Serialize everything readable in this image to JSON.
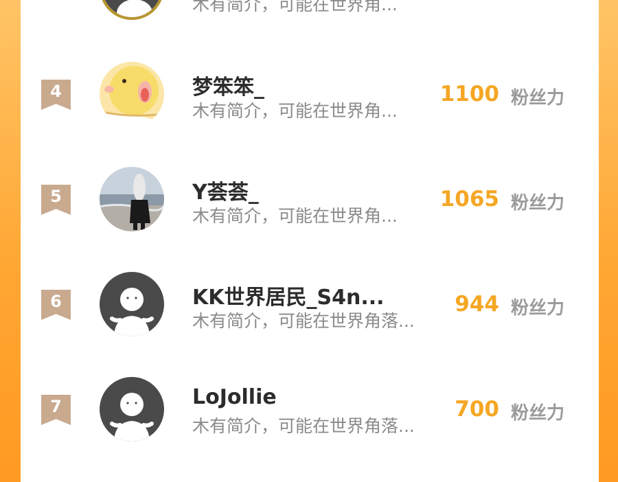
{
  "top_partial": {
    "bio": "木有简介，可能在世界角..."
  },
  "rows": [
    {
      "rank": "4",
      "name": "梦笨笨_",
      "bio": "木有简介，可能在世界角...",
      "score": "1100",
      "unit": "粉丝力",
      "avatar": "cartoon-chick-avatar"
    },
    {
      "rank": "5",
      "name": "Y荟荟_",
      "bio": "木有简介，可能在世界角...",
      "score": "1065",
      "unit": "粉丝力",
      "avatar": "beach-photo-avatar"
    },
    {
      "rank": "6",
      "name": "KK世界居民_S4n...",
      "bio": "木有简介，可能在世界角落...",
      "score": "944",
      "unit": "粉丝力",
      "avatar": "default-user-avatar"
    },
    {
      "rank": "7",
      "name": "LoJollie",
      "bio": "木有简介，可能在世界角落...",
      "score": "700",
      "unit": "粉丝力",
      "avatar": "default-user-avatar"
    }
  ],
  "colors": {
    "background_top": "#ffc466",
    "background_bottom": "#ff9a22",
    "score": "#f5a623",
    "rank_badge": "#c9aa8f",
    "gold_ring": "#b8962e",
    "default_avatar": "#4a4a4a"
  }
}
